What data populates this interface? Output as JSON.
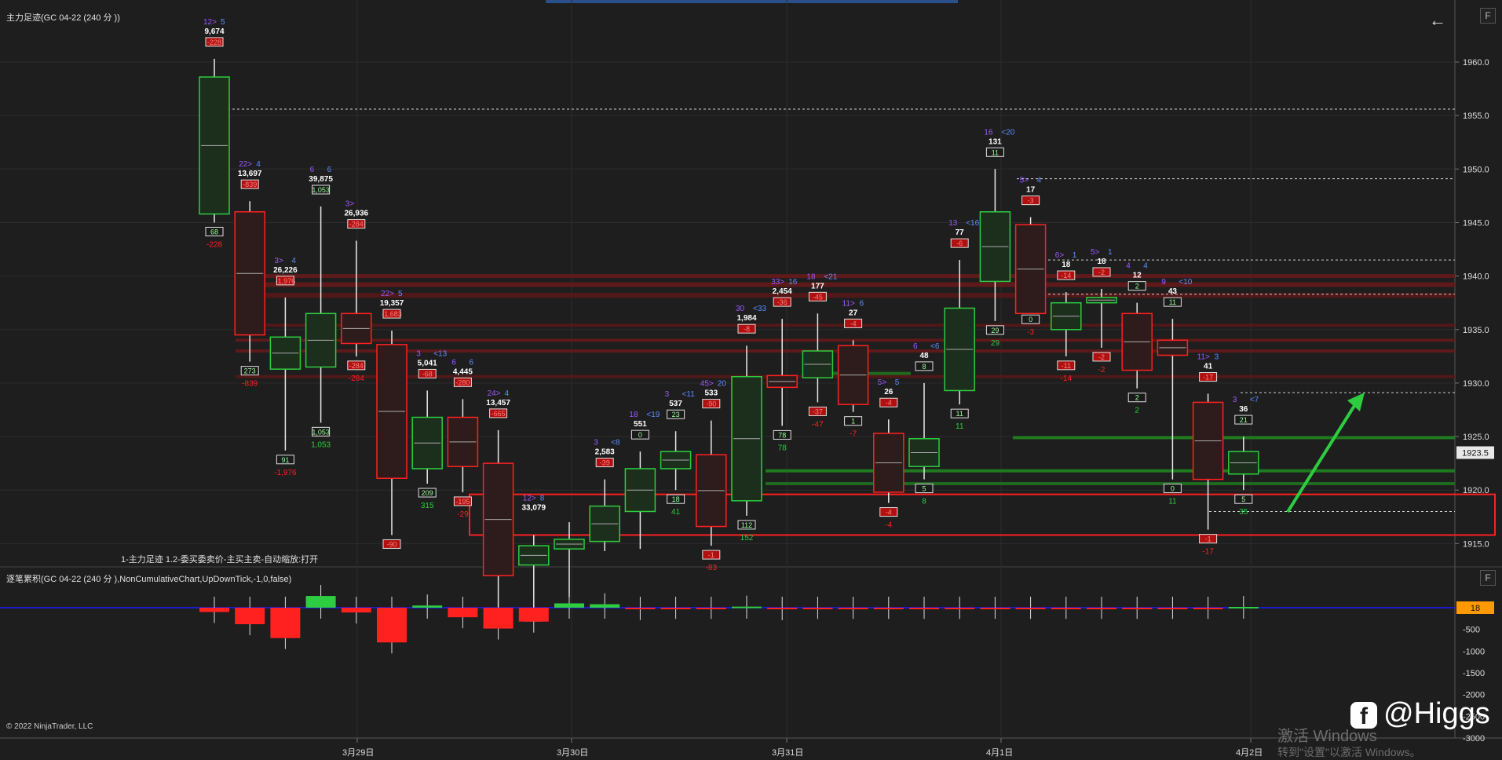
{
  "main_panel": {
    "title": "主力足迹(GC 04-22 (240 分 ))",
    "indicator_text": "1-主力足迹 1.2-委买委卖价-主买主卖-自动缩放:打开",
    "button_f": "F",
    "price_axis": {
      "labels": [
        "1960.0",
        "1955.0",
        "1950.0",
        "1945.0",
        "1940.0",
        "1935.0",
        "1930.0",
        "1925.0",
        "1920.0",
        "1915.0"
      ],
      "current_price": "1923.5"
    }
  },
  "sub_panel": {
    "title": "逐笔累积(GC 04-22 (240 分 ),NonCumulativeChart,UpDownTick,-1,0,false)",
    "button_f": "F",
    "axis_labels": [
      "-500",
      "-1000",
      "-1500",
      "-2000",
      "-2500",
      "-3000"
    ],
    "current_value": "18"
  },
  "time_axis": [
    "3月29日",
    "3月30日",
    "3月31日",
    "4月1日",
    "4月2日"
  ],
  "copyright": "© 2022 NinjaTrader, LLC",
  "watermark": {
    "activate_line1": "激活 Windows",
    "activate_line2": "转到\"设置\"以激活 Windows。",
    "brand": "@Higgs"
  },
  "colors": {
    "background": "#1e1e1e",
    "up": "#2ecc40",
    "down": "#ff2020",
    "label_purple": "#9b59ff",
    "label_blue": "#5b8dff",
    "zero_line": "#1a1aff"
  },
  "chart_data": {
    "type": "candlestick",
    "candles": [
      {
        "o": 1945.8,
        "h": 1960.3,
        "l": 1945.0,
        "c": 1958.6,
        "top_a": "12>",
        "top_b": "5",
        "vol": "9,674",
        "delta_top": "-228",
        "delta_bot": "-228",
        "box_bot": "68"
      },
      {
        "o": 1946.0,
        "h": 1947.0,
        "l": 1932.0,
        "c": 1934.5,
        "top_a": "22>",
        "top_b": "4",
        "vol": "13,697",
        "delta_top": "-839",
        "delta_bot": "-839",
        "box_bot": "273"
      },
      {
        "o": 1931.3,
        "h": 1938.0,
        "l": 1923.7,
        "c": 1934.3,
        "top_a": "3>",
        "top_b": "4",
        "vol": "26,226",
        "delta_top": "-1,976",
        "delta_bot": "-1,976",
        "box_bot": "91"
      },
      {
        "o": 1931.5,
        "h": 1946.5,
        "l": 1926.3,
        "c": 1936.5,
        "top_a": "6",
        "top_b": "6",
        "vol": "39,875",
        "delta_top": "1,053",
        "delta_bot": "1,053",
        "box_bot": "1,053"
      },
      {
        "o": 1936.5,
        "h": 1943.3,
        "l": 1932.5,
        "c": 1933.7,
        "top_a": "3>",
        "top_b": "",
        "vol": "26,936",
        "delta_top": "-284",
        "delta_bot": "-284",
        "box_bot": "-284"
      },
      {
        "o": 1933.6,
        "h": 1934.9,
        "l": 1915.8,
        "c": 1921.1,
        "top_a": "22>",
        "top_b": "5",
        "vol": "19,357",
        "delta_top": "-1,683",
        "delta_bot": "",
        "box_bot": "-90"
      },
      {
        "o": 1922.0,
        "h": 1929.3,
        "l": 1920.6,
        "c": 1926.8,
        "top_a": "3",
        "top_b": "<13",
        "vol": "5,041",
        "delta_top": "-68",
        "delta_bot": "315",
        "box_bot": "209"
      },
      {
        "o": 1926.8,
        "h": 1928.5,
        "l": 1919.8,
        "c": 1922.2,
        "top_a": "6",
        "top_b": "6",
        "vol": "4,445",
        "delta_top": "-280",
        "delta_bot": "-29",
        "box_bot": "-195"
      },
      {
        "o": 1922.5,
        "h": 1925.6,
        "l": 1909.0,
        "c": 1912.0,
        "top_a": "24>",
        "top_b": "4",
        "vol": "13,457",
        "delta_top": "-665",
        "delta_bot": "",
        "box_bot": ""
      },
      {
        "o": 1913.0,
        "h": 1915.8,
        "l": 1909.0,
        "c": 1914.8,
        "top_a": "12>",
        "top_b": "8",
        "vol": "33,079",
        "delta_top": "",
        "delta_bot": "",
        "box_bot": "233"
      },
      {
        "o": 1914.5,
        "h": 1917.0,
        "l": 1910.0,
        "c": 1915.4,
        "top_a": "",
        "top_b": "",
        "vol": "",
        "delta_top": "",
        "delta_bot": "",
        "box_bot": ""
      },
      {
        "o": 1915.2,
        "h": 1921.0,
        "l": 1914.3,
        "c": 1918.5,
        "top_a": "3",
        "top_b": "<8",
        "vol": "2,583",
        "delta_top": "-39",
        "delta_bot": "",
        "box_bot": ""
      },
      {
        "o": 1918.0,
        "h": 1923.6,
        "l": 1914.5,
        "c": 1922.0,
        "top_a": "18",
        "top_b": "<19",
        "vol": "551",
        "delta_top": "0",
        "delta_bot": "",
        "box_bot": ""
      },
      {
        "o": 1922.0,
        "h": 1925.5,
        "l": 1920.0,
        "c": 1923.6,
        "top_a": "3",
        "top_b": "<11",
        "vol": "537",
        "delta_top": "23",
        "delta_bot": "41",
        "box_bot": "18"
      },
      {
        "o": 1923.3,
        "h": 1926.5,
        "l": 1914.8,
        "c": 1916.6,
        "top_a": "45>",
        "top_b": "20",
        "vol": "533",
        "delta_top": "-90",
        "delta_bot": "-83",
        "box_bot": "-1"
      },
      {
        "o": 1919.0,
        "h": 1933.5,
        "l": 1917.6,
        "c": 1930.6,
        "top_a": "30",
        "top_b": "<33",
        "vol": "1,984",
        "delta_top": "-8",
        "delta_bot": "152",
        "box_bot": "112"
      },
      {
        "o": 1930.7,
        "h": 1936.0,
        "l": 1926.0,
        "c": 1929.6,
        "top_a": "33>",
        "top_b": "16",
        "vol": "2,454",
        "delta_top": "-36",
        "delta_bot": "78",
        "box_bot": "78"
      },
      {
        "o": 1930.5,
        "h": 1936.5,
        "l": 1928.2,
        "c": 1933.0,
        "top_a": "18",
        "top_b": "<21",
        "vol": "177",
        "delta_top": "-45",
        "delta_bot": "-47",
        "box_bot": "-37"
      },
      {
        "o": 1933.5,
        "h": 1934.0,
        "l": 1927.3,
        "c": 1928.0,
        "top_a": "11>",
        "top_b": "6",
        "vol": "27",
        "delta_top": "-4",
        "delta_bot": "-7",
        "box_bot": "1"
      },
      {
        "o": 1925.3,
        "h": 1926.6,
        "l": 1918.8,
        "c": 1919.8,
        "top_a": "5>",
        "top_b": "5",
        "vol": "26",
        "delta_top": "-4",
        "delta_bot": "-4",
        "box_bot": "-4"
      },
      {
        "o": 1922.2,
        "h": 1930.0,
        "l": 1921.0,
        "c": 1924.8,
        "top_a": "6",
        "top_b": "<6",
        "vol": "48",
        "delta_top": "8",
        "delta_bot": "8",
        "box_bot": "5"
      },
      {
        "o": 1929.3,
        "h": 1941.5,
        "l": 1928.0,
        "c": 1937.0,
        "top_a": "13",
        "top_b": "<16",
        "vol": "77",
        "delta_top": "-6",
        "delta_bot": "11",
        "box_bot": "11"
      },
      {
        "o": 1939.5,
        "h": 1950.0,
        "l": 1935.8,
        "c": 1946.0,
        "top_a": "16",
        "top_b": "<20",
        "vol": "131",
        "delta_top": "11",
        "delta_bot": "29",
        "box_bot": "29"
      },
      {
        "o": 1944.8,
        "h": 1945.5,
        "l": 1936.8,
        "c": 1936.5,
        "top_a": "5>",
        "top_b": "4",
        "vol": "17",
        "delta_top": "-3",
        "delta_bot": "-3",
        "box_bot": "0"
      },
      {
        "o": 1935.0,
        "h": 1938.5,
        "l": 1932.5,
        "c": 1937.5,
        "top_a": "6>",
        "top_b": "1",
        "vol": "18",
        "delta_top": "-14",
        "delta_bot": "-14",
        "box_bot": "-11"
      },
      {
        "o": 1937.5,
        "h": 1938.8,
        "l": 1933.3,
        "c": 1938.0,
        "top_a": "5>",
        "top_b": "1",
        "vol": "18",
        "delta_top": "-2",
        "delta_bot": "-2",
        "box_bot": "-2"
      },
      {
        "o": 1936.5,
        "h": 1937.5,
        "l": 1929.5,
        "c": 1931.2,
        "top_a": "4",
        "top_b": "4",
        "vol": "12",
        "delta_top": "2",
        "delta_bot": "2",
        "box_bot": "2"
      },
      {
        "o": 1934.0,
        "h": 1936.0,
        "l": 1921.0,
        "c": 1932.6,
        "top_a": "9",
        "top_b": "<10",
        "vol": "43",
        "delta_top": "11",
        "delta_bot": "11",
        "box_bot": "0"
      },
      {
        "o": 1928.2,
        "h": 1929.0,
        "l": 1916.3,
        "c": 1921.0,
        "top_a": "11>",
        "top_b": "3",
        "vol": "41",
        "delta_top": "-17",
        "delta_bot": "-17",
        "box_bot": "-1"
      },
      {
        "o": 1921.5,
        "h": 1925.0,
        "l": 1920.0,
        "c": 1923.6,
        "top_a": "3",
        "top_b": "<7",
        "vol": "36",
        "delta_top": "21",
        "delta_bot": "35",
        "box_bot": "5"
      }
    ],
    "sub_bars": [
      -100,
      -380,
      -700,
      270,
      -110,
      -800,
      50,
      -220,
      -480,
      -320,
      100,
      80,
      -30,
      -5,
      -5,
      25,
      -35,
      -5,
      -5,
      -5,
      -5,
      -5,
      -5,
      -5,
      -5,
      -5,
      -5,
      -5,
      -5,
      18
    ],
    "sub_ylim": [
      -3000,
      500
    ],
    "ylim": [
      1913.5,
      1963.0
    ]
  }
}
